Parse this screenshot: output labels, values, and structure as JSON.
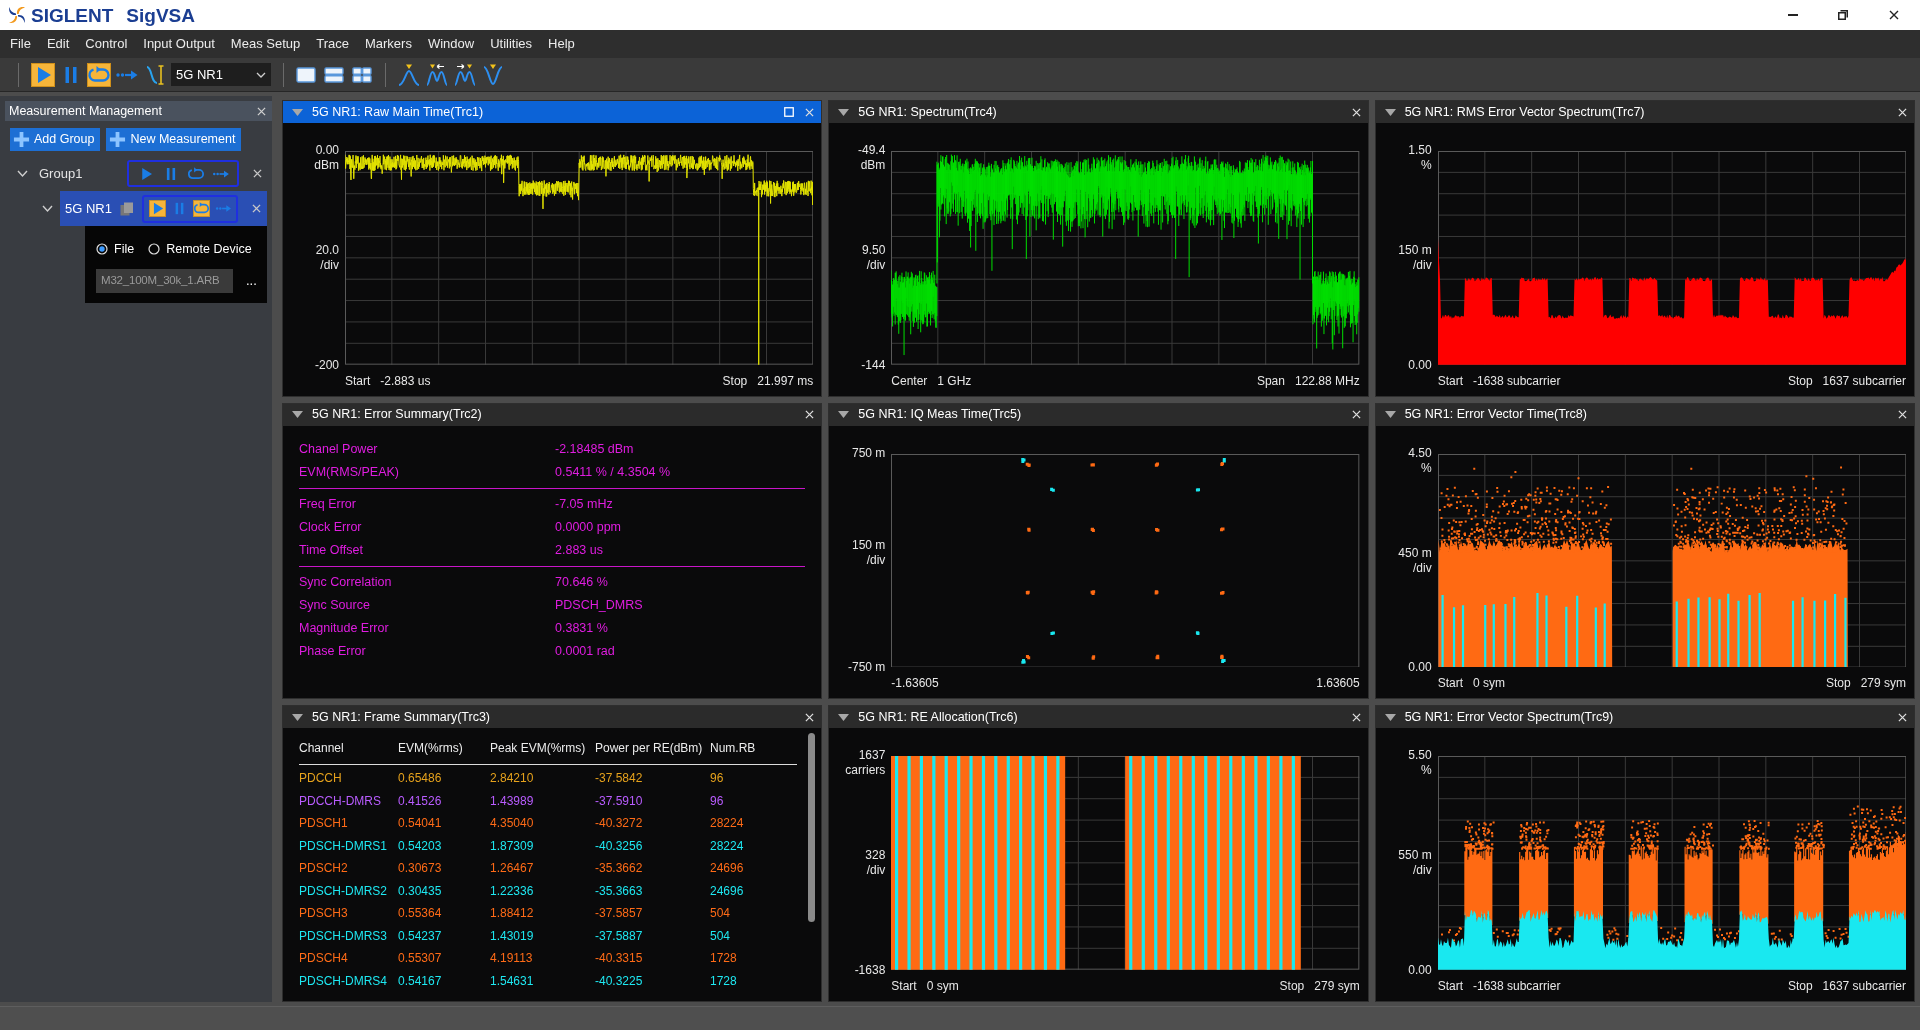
{
  "window": {
    "brand": "SIGLENT",
    "title": "SigVSA"
  },
  "menu": [
    "File",
    "Edit",
    "Control",
    "Input Output",
    "Meas Setup",
    "Trace",
    "Markers",
    "Window",
    "Utilities",
    "Help"
  ],
  "toolbar": {
    "run_controls": [
      {
        "kind": "play",
        "on": true
      },
      {
        "kind": "pause",
        "on": false
      },
      {
        "kind": "loop",
        "on": true
      },
      {
        "kind": "step",
        "on": false
      }
    ],
    "measurement": "5G NR1"
  },
  "measurement_management": {
    "title": "Measurement Management",
    "buttons": [
      "Add Group",
      "New Measurement"
    ],
    "tree": [
      {
        "kind": "group",
        "label": "Group1",
        "expanded": true,
        "selected": false,
        "controls": [
          {
            "kind": "play",
            "on": false
          },
          {
            "kind": "pause",
            "on": false
          },
          {
            "kind": "loop",
            "on": false
          },
          {
            "kind": "step",
            "on": false
          }
        ],
        "children": [
          {
            "kind": "measurement",
            "label": "5G NR1",
            "expanded": true,
            "selected": true,
            "controls": [
              {
                "kind": "play",
                "on": true
              },
              {
                "kind": "pause",
                "on": false
              },
              {
                "kind": "loop",
                "on": true
              },
              {
                "kind": "step",
                "on": false
              }
            ],
            "source": {
              "options": [
                {
                  "label": "File",
                  "selected": true
                },
                {
                  "label": "Remote Device",
                  "selected": false
                }
              ],
              "file": {
                "value": "M32_100M_30k_1.ARB",
                "disabled": true
              },
              "browse": "..."
            }
          }
        ]
      }
    ]
  },
  "panels": [
    {
      "title": "5G NR1: Raw Main Time(Trc1)",
      "selected": true,
      "kind": "power_time",
      "axes": {
        "y_top": {
          "value": "0.00",
          "unit": "dBm"
        },
        "y_mid": {
          "value": "20.0",
          "unit": "/div"
        },
        "y_bottom": {
          "value": "-200"
        },
        "x_start": {
          "caption": "Start",
          "value": "-2.883 us"
        },
        "x_stop": {
          "caption": "Stop",
          "value": "21.997 ms"
        }
      }
    },
    {
      "title": "5G NR1: Spectrum(Trc4)",
      "selected": false,
      "kind": "spectrum",
      "axes": {
        "y_top": {
          "value": "-49.4",
          "unit": "dBm"
        },
        "y_mid": {
          "value": "9.50",
          "unit": "/div"
        },
        "y_bottom": {
          "value": "-144"
        },
        "x_start": {
          "caption": "Center",
          "value": "1 GHz"
        },
        "x_stop": {
          "caption": "Span",
          "value": "122.88 MHz"
        }
      }
    },
    {
      "title": "5G NR1: RMS Error Vector Spectrum(Trc7)",
      "selected": false,
      "kind": "rms_error_vector_spectrum",
      "axes": {
        "y_top": {
          "value": "1.50",
          "unit": "%"
        },
        "y_mid": {
          "value": "150 m",
          "unit": "/div"
        },
        "y_bottom": {
          "value": "0.00"
        },
        "x_start": {
          "caption": "Start",
          "value": "-1638 subcarrier"
        },
        "x_stop": {
          "caption": "Stop",
          "value": "1637 subcarrier"
        }
      }
    },
    {
      "title": "5G NR1: Error Summary(Trc2)",
      "selected": false,
      "kind": "error_summary",
      "groups": [
        {
          "rows": [
            {
              "label": "Chanel Power",
              "value": "-2.18485 dBm"
            },
            {
              "label": "EVM(RMS/PEAK)",
              "value": "0.5411 % / 4.3504 %"
            }
          ]
        },
        {
          "rows": [
            {
              "label": "Freq Error",
              "value": "-7.05 mHz"
            },
            {
              "label": "Clock Error",
              "value": "0.0000 ppm"
            },
            {
              "label": "Time Offset",
              "value": "2.883 us"
            }
          ]
        },
        {
          "rows": [
            {
              "label": "Sync Correlation",
              "value": "70.646 %"
            },
            {
              "label": "Sync Source",
              "value": "PDSCH_DMRS"
            },
            {
              "label": "Magnitude Error",
              "value": "0.3831 %"
            },
            {
              "label": "Phase Error",
              "value": "0.0001 rad"
            }
          ]
        }
      ]
    },
    {
      "title": "5G NR1: IQ Meas Time(Trc5)",
      "selected": false,
      "kind": "iq_constellation",
      "axes": {
        "y_top": {
          "value": "750 m"
        },
        "y_mid": {
          "value": "150 m",
          "unit": "/div"
        },
        "y_bottom": {
          "value": "-750 m"
        },
        "x_start": {
          "value": "-1.63605"
        },
        "x_stop": {
          "value": "1.63605"
        }
      }
    },
    {
      "title": "5G NR1: Error Vector Time(Trc8)",
      "selected": false,
      "kind": "error_vector_time",
      "axes": {
        "y_top": {
          "value": "4.50",
          "unit": "%"
        },
        "y_mid": {
          "value": "450 m",
          "unit": "/div"
        },
        "y_bottom": {
          "value": "0.00"
        },
        "x_start": {
          "caption": "Start",
          "value": "0 sym"
        },
        "x_stop": {
          "caption": "Stop",
          "value": "279 sym"
        }
      }
    },
    {
      "title": "5G NR1: Frame Summary(Trc3)",
      "selected": false,
      "kind": "frame_summary",
      "columns": [
        "Channel",
        "EVM(%rms)",
        "Peak EVM(%rms)",
        "Power per RE(dBm)",
        "Num.RB"
      ],
      "rows": [
        {
          "color": "#e6a21c",
          "cells": [
            "PDCCH",
            "0.65486",
            "2.84210",
            "-37.5842",
            "96"
          ]
        },
        {
          "color": "#b95cff",
          "cells": [
            "PDCCH-DMRS",
            "0.41526",
            "1.43989",
            "-37.5910",
            "96"
          ]
        },
        {
          "color": "#ff6b17",
          "cells": [
            "PDSCH1",
            "0.54041",
            "4.35040",
            "-40.3272",
            "28224"
          ]
        },
        {
          "color": "#1ee8f2",
          "cells": [
            "PDSCH-DMRS1",
            "0.54203",
            "1.87309",
            "-40.3256",
            "28224"
          ]
        },
        {
          "color": "#ff6b17",
          "cells": [
            "PDSCH2",
            "0.30673",
            "1.26467",
            "-35.3662",
            "24696"
          ]
        },
        {
          "color": "#1ee8f2",
          "cells": [
            "PDSCH-DMRS2",
            "0.30435",
            "1.22336",
            "-35.3663",
            "24696"
          ]
        },
        {
          "color": "#ff6b17",
          "cells": [
            "PDSCH3",
            "0.55364",
            "1.88412",
            "-37.5857",
            "504"
          ]
        },
        {
          "color": "#1ee8f2",
          "cells": [
            "PDSCH-DMRS3",
            "0.54237",
            "1.43019",
            "-37.5887",
            "504"
          ]
        },
        {
          "color": "#ff6b17",
          "cells": [
            "PDSCH4",
            "0.55307",
            "4.19113",
            "-40.3315",
            "1728"
          ]
        },
        {
          "color": "#1ee8f2",
          "cells": [
            "PDSCH-DMRS4",
            "0.54167",
            "1.54631",
            "-40.3225",
            "1728"
          ]
        }
      ]
    },
    {
      "title": "5G NR1: RE Allocation(Trc6)",
      "selected": false,
      "kind": "re_allocation",
      "axes": {
        "y_top": {
          "value": "1637",
          "unit": "carriers"
        },
        "y_mid": {
          "value": "328",
          "unit": "/div"
        },
        "y_bottom": {
          "value": "-1638"
        },
        "x_start": {
          "caption": "Start",
          "value": "0 sym"
        },
        "x_stop": {
          "caption": "Stop",
          "value": "279 sym"
        }
      }
    },
    {
      "title": "5G NR1: Error Vector Spectrum(Trc9)",
      "selected": false,
      "kind": "error_vector_spectrum",
      "axes": {
        "y_top": {
          "value": "5.50",
          "unit": "%"
        },
        "y_mid": {
          "value": "550 m",
          "unit": "/div"
        },
        "y_bottom": {
          "value": "0.00"
        },
        "x_start": {
          "caption": "Start",
          "value": "-1638 subcarrier"
        },
        "x_stop": {
          "caption": "Stop",
          "value": "1637 subcarrier"
        }
      }
    }
  ]
}
